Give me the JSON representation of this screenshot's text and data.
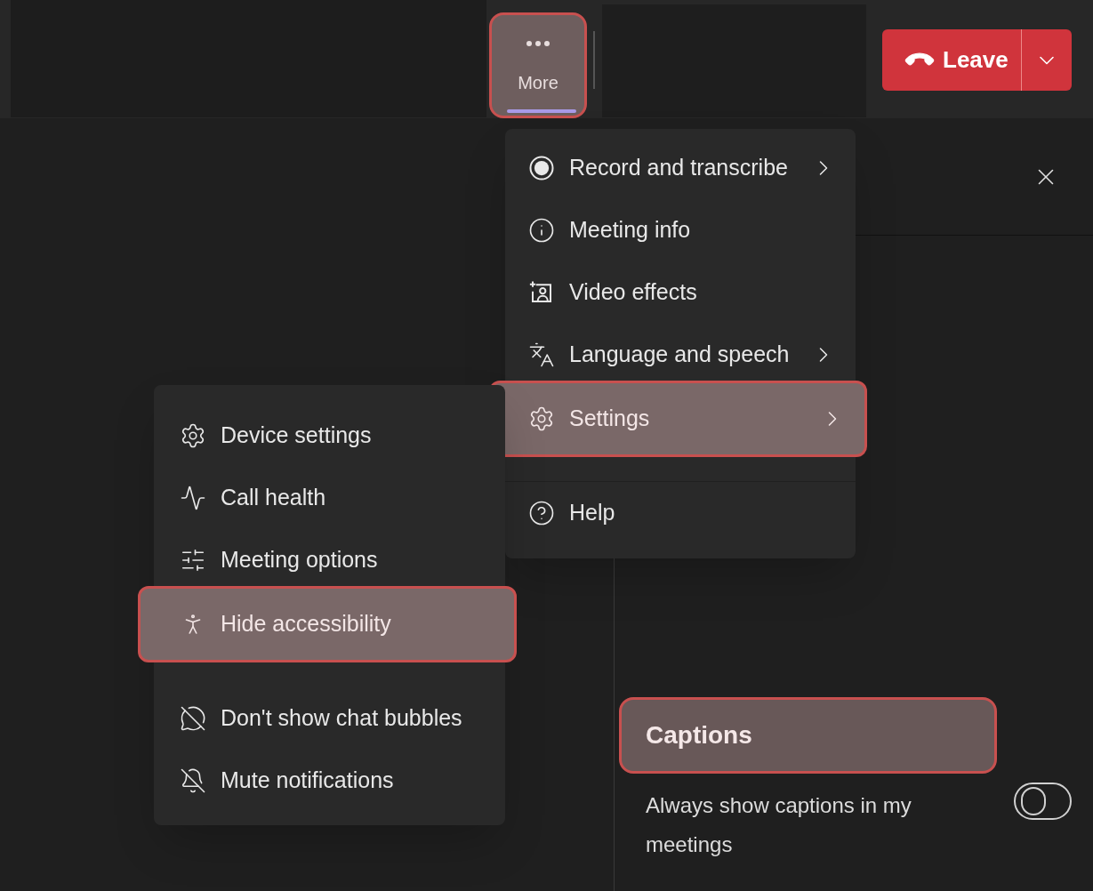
{
  "toolbar": {
    "more_button": {
      "label": "More",
      "selected": true,
      "highlighted": true
    },
    "leave_button": {
      "label": "Leave"
    }
  },
  "more_menu": {
    "sections": [
      [
        {
          "label": "Record and transcribe",
          "submenu": true,
          "highlighted": false
        },
        {
          "label": "Meeting info",
          "submenu": false,
          "highlighted": false
        },
        {
          "label": "Video effects",
          "submenu": false,
          "highlighted": false
        },
        {
          "label": "Language and speech",
          "submenu": true,
          "highlighted": false
        },
        {
          "label": "Settings",
          "submenu": true,
          "highlighted": true
        }
      ],
      [
        {
          "label": "Help",
          "submenu": false,
          "highlighted": false
        }
      ]
    ]
  },
  "settings_submenu": {
    "sections": [
      [
        {
          "label": "Device settings",
          "submenu": false,
          "highlighted": false
        },
        {
          "label": "Call health",
          "submenu": false,
          "highlighted": false
        },
        {
          "label": "Meeting options",
          "submenu": false,
          "highlighted": false
        },
        {
          "label": "Hide accessibility",
          "submenu": false,
          "highlighted": true
        }
      ],
      [
        {
          "label": "Don't show chat bubbles",
          "submenu": false,
          "highlighted": false
        },
        {
          "label": "Mute notifications",
          "submenu": false,
          "highlighted": false
        }
      ]
    ]
  },
  "captions_panel": {
    "heading": "Captions",
    "highlighted": true,
    "setting": {
      "label": "Always show captions in my meetings",
      "on": false
    }
  }
}
